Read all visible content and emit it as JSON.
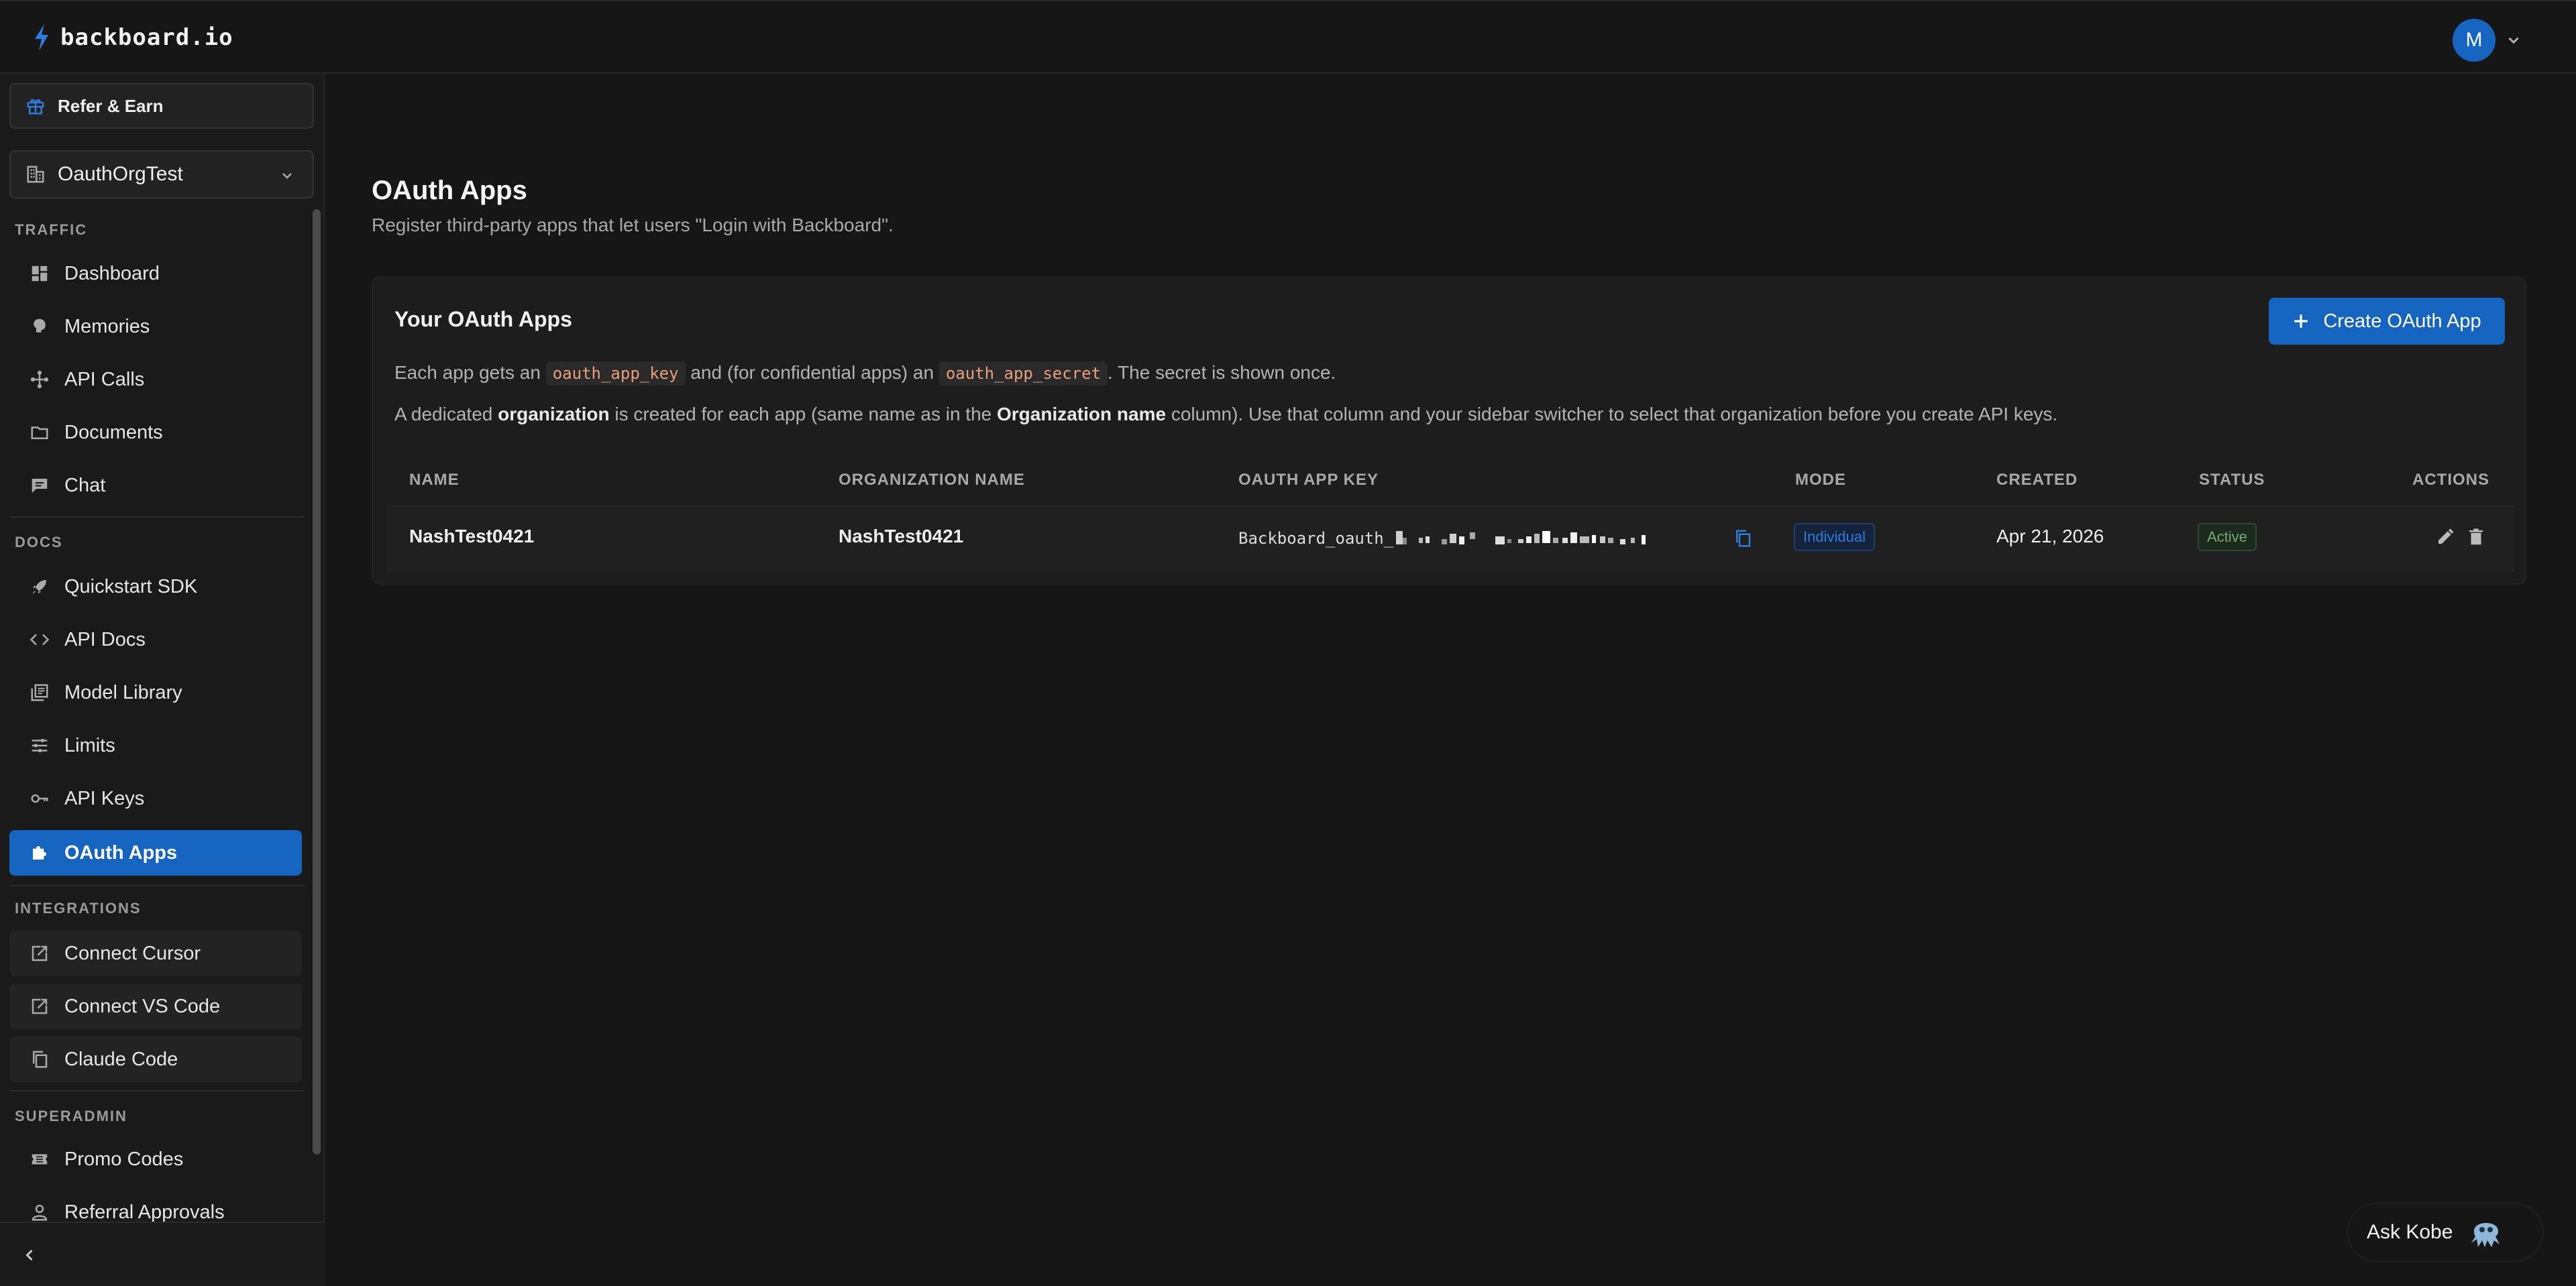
{
  "app": {
    "brand_name": "backboard.io",
    "user_initial": "M",
    "accent_color": "#1565c0"
  },
  "sidebar": {
    "refer_label": "Refer & Earn",
    "org_name": "OauthOrgTest",
    "sections": {
      "traffic": "TRAFFIC",
      "docs": "DOCS",
      "integrations": "INTEGRATIONS",
      "superadmin": "SUPERADMIN"
    },
    "traffic_items": [
      {
        "label": "Dashboard",
        "icon": "dashboard-icon"
      },
      {
        "label": "Memories",
        "icon": "brain-icon"
      },
      {
        "label": "API Calls",
        "icon": "network-icon"
      },
      {
        "label": "Documents",
        "icon": "folder-icon"
      },
      {
        "label": "Chat",
        "icon": "chat-icon"
      }
    ],
    "docs_items": [
      {
        "label": "Quickstart SDK",
        "icon": "rocket-icon"
      },
      {
        "label": "API Docs",
        "icon": "code-icon"
      },
      {
        "label": "Model Library",
        "icon": "library-icon"
      },
      {
        "label": "Limits",
        "icon": "sliders-icon"
      },
      {
        "label": "API Keys",
        "icon": "key-icon"
      },
      {
        "label": "OAuth Apps",
        "icon": "puzzle-icon",
        "active": true
      }
    ],
    "integration_items": [
      {
        "label": "Connect Cursor",
        "icon": "external-link-icon"
      },
      {
        "label": "Connect VS Code",
        "icon": "external-link-icon"
      },
      {
        "label": "Claude Code",
        "icon": "copy-icon"
      }
    ],
    "superadmin_items": [
      {
        "label": "Promo Codes",
        "icon": "ticket-icon"
      },
      {
        "label": "Referral Approvals",
        "icon": "user-check-icon"
      }
    ]
  },
  "main": {
    "title": "OAuth Apps",
    "subtitle": "Register third-party apps that let users \"Login with Backboard\".",
    "card": {
      "title": "Your OAuth Apps",
      "create_button": "Create OAuth App",
      "info1": {
        "pre": "Each app gets an",
        "code1": "oauth_app_key",
        "mid": "and (for confidential apps) an",
        "code2": "oauth_app_secret",
        "post": ". The secret is shown once."
      },
      "info2": {
        "pre": "A dedicated",
        "bold1": "organization",
        "mid": "is created for each app (same name as in the",
        "bold2": "Organization name",
        "post": "column). Use that column and your sidebar switcher to select that organization before you create API keys."
      }
    },
    "table": {
      "columns": [
        "NAME",
        "ORGANIZATION NAME",
        "OAUTH APP KEY",
        "MODE",
        "CREATED",
        "STATUS",
        "ACTIONS"
      ],
      "rows": [
        {
          "name": "NashTest0421",
          "organization_name": "NashTest0421",
          "oauth_app_key_prefix": "Backboard_oauth_",
          "mode": "Individual",
          "created": "Apr 21, 2026",
          "status": "Active"
        }
      ]
    }
  },
  "assistant": {
    "label": "Ask Kobe"
  }
}
